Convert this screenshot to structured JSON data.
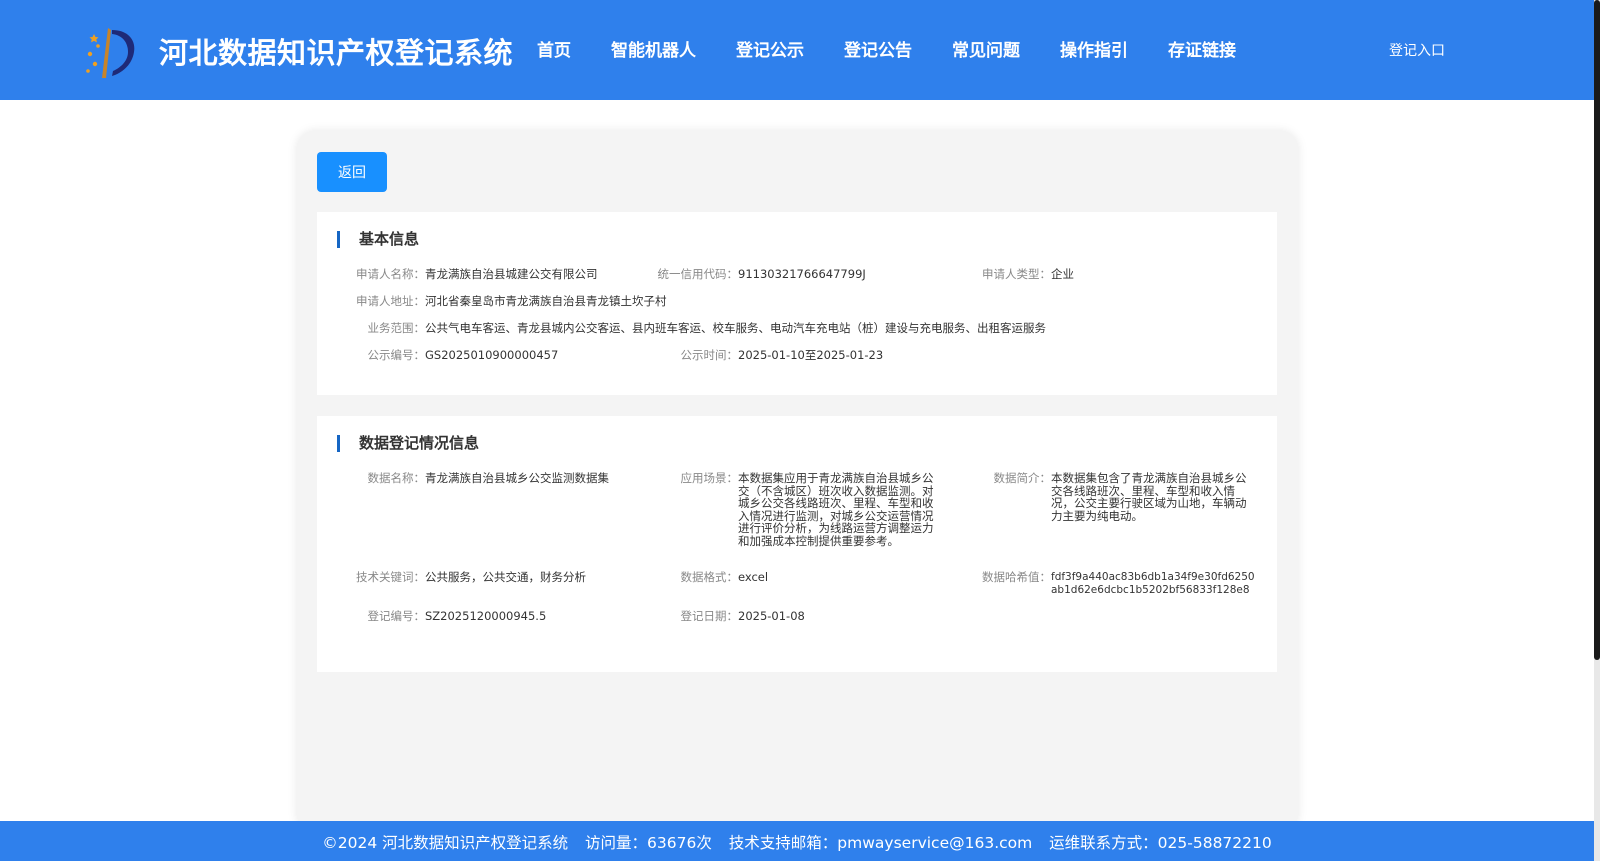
{
  "header": {
    "site_title": "河北数据知识产权登记系统",
    "nav": [
      "首页",
      "智能机器人",
      "登记公示",
      "登记公告",
      "常见问题",
      "操作指引",
      "存证链接"
    ],
    "login_label": "登记入口"
  },
  "main": {
    "back_label": "返回",
    "basic_info": {
      "title": "基本信息",
      "applicant_name_label": "申请人名称：",
      "applicant_name": "青龙满族自治县城建公交有限公司",
      "credit_code_label": "统一信用代码：",
      "credit_code": "91130321766647799J",
      "applicant_type_label": "申请人类型：",
      "applicant_type": "企业",
      "address_label": "申请人地址：",
      "address": "河北省秦皇岛市青龙满族自治县青龙镇土坎子村",
      "business_scope_label": "业务范围：",
      "business_scope": "公共气电车客运、青龙县城内公交客运、县内班车客运、校车服务、电动汽车充电站（桩）建设与充电服务、出租客运服务",
      "notice_no_label": "公示编号：",
      "notice_no": "GS2025010900000457",
      "notice_time_label": "公示时间：",
      "notice_time": "2025-01-10至2025-01-23"
    },
    "data_info": {
      "title": "数据登记情况信息",
      "data_name_label": "数据名称：",
      "data_name": "青龙满族自治县城乡公交监测数据集",
      "scenario_label": "应用场景：",
      "scenario": "本数据集应用于青龙满族自治县城乡公交（不含城区）班次收入数据监测。对城乡公交各线路班次、里程、车型和收入情况进行监测，对城乡公交运营情况进行评价分析，为线路运营方调整运力和加强成本控制提供重要参考。",
      "summary_label": "数据简介：",
      "summary": "本数据集包含了青龙满族自治县城乡公交各线路班次、里程、车型和收入情况，公交主要行驶区域为山地，车辆动力主要为纯电动。",
      "keywords_label": "技术关键词：",
      "keywords": "公共服务，公共交通，财务分析",
      "format_label": "数据格式：",
      "format": "excel",
      "hash_label": "数据哈希值：",
      "hash": "fdf3f9a440ac83b6db1a34f9e30fd6250ab1d62e6dcbc1b5202bf56833f128e8",
      "reg_no_label": "登记编号：",
      "reg_no": "SZ2025120000945.5",
      "reg_date_label": "登记日期：",
      "reg_date": "2025-01-08"
    }
  },
  "footer": {
    "copyright": "©2024 河北数据知识产权登记系统",
    "visits": "访问量：63676次",
    "email": "技术支持邮箱：pmwayservice@163.com",
    "contact": "运维联系方式：025-58872210"
  },
  "colors": {
    "primary": "#2f80ec",
    "button": "#1890ff",
    "title_bar": "#1666c4"
  }
}
